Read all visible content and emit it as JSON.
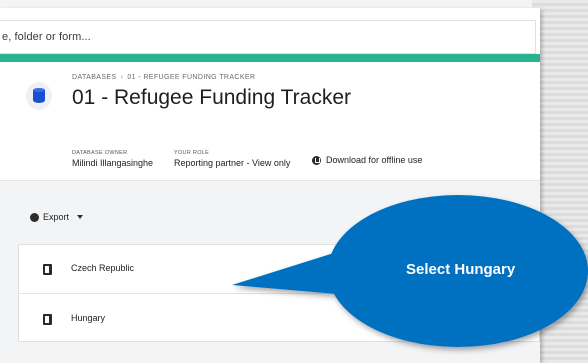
{
  "search": {
    "text": "e, folder or form..."
  },
  "breadcrumb": {
    "root": "DATABASES",
    "separator": "›",
    "current": "01 - REFUGEE FUNDING TRACKER"
  },
  "database": {
    "title": "01 - Refugee Funding Tracker"
  },
  "meta": {
    "owner_label": "DATABASE OWNER",
    "owner_value": "Milindi Illangasinghe",
    "role_label": "YOUR ROLE",
    "role_value": "Reporting partner - View only",
    "download_label": "Download for offline use"
  },
  "toolbar": {
    "export_label": "Export"
  },
  "forms": [
    {
      "label": "Czech Republic"
    },
    {
      "label": "Hungary"
    }
  ],
  "callout": {
    "text": "Select Hungary",
    "color": "#0070c0"
  },
  "colors": {
    "accent_band": "#27b38d",
    "database_icon": "#1a4fcf"
  },
  "icons": {
    "database": "database-icon",
    "download": "download-icon",
    "export": "export-icon",
    "form": "form-icon",
    "caret": "chevron-down-icon"
  }
}
